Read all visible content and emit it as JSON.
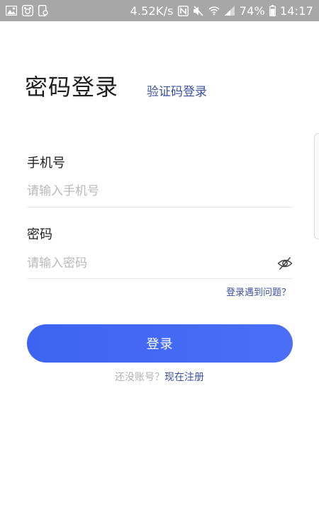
{
  "status_bar": {
    "network_speed": "4.52K/s",
    "battery": "74%",
    "time": "14:17",
    "left_icons": [
      "image-icon",
      "baby-icon",
      "phone-settings-icon"
    ],
    "right_icons": [
      "nfc-icon",
      "mute-icon",
      "wifi-icon",
      "signal-icon",
      "battery-icon"
    ]
  },
  "login": {
    "title": "密码登录",
    "alt_login": "验证码登录",
    "phone_label": "手机号",
    "phone_placeholder": "请输入手机号",
    "password_label": "密码",
    "password_placeholder": "请输入密码",
    "help_link": "登录遇到问题？",
    "login_button": "登录",
    "register_hint": "还没账号？",
    "register_link": "现在注册"
  },
  "colors": {
    "accent": "#4a6ff6",
    "link": "#3a4fa0",
    "status_bar": "#a7a7a7"
  }
}
